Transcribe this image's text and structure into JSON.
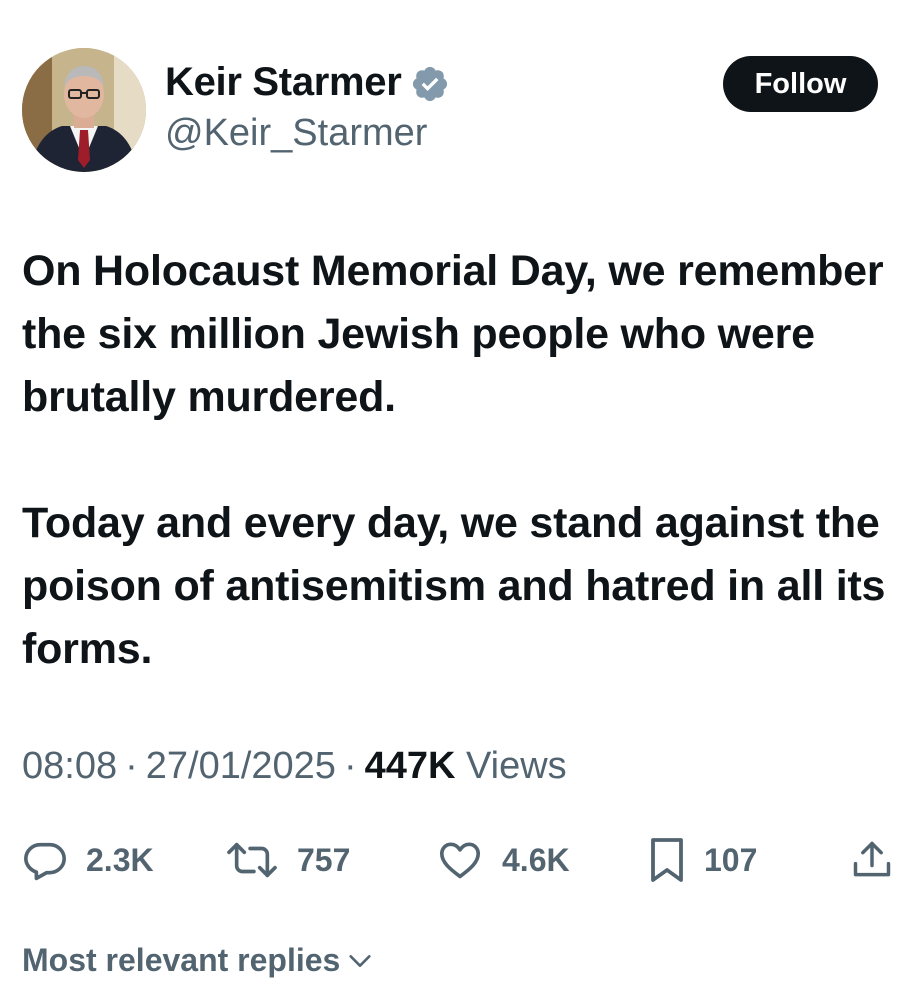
{
  "author": {
    "display_name": "Keir Starmer",
    "handle": "@Keir_Starmer",
    "verified_badge_color": "#829aab"
  },
  "follow_label": "Follow",
  "tweet": {
    "paragraphs": [
      "On Holocaust Memorial Day, we remember the six million Jewish people who were brutally murdered.",
      "Today and every day, we stand against the poison of antisemitism and hatred in all its forms."
    ],
    "time": "08:08",
    "date": "27/01/2025",
    "views_count": "447K",
    "views_label": "Views",
    "separator": "·"
  },
  "actions": {
    "replies": "2.3K",
    "reposts": "757",
    "likes": "4.6K",
    "bookmarks": "107",
    "icons": [
      "reply-icon",
      "repost-icon",
      "like-icon",
      "bookmark-icon",
      "share-icon"
    ]
  },
  "replies_sort_label": "Most relevant replies",
  "colors": {
    "text_primary": "#0f1419",
    "text_secondary": "#536471",
    "button_bg": "#0f1419"
  }
}
